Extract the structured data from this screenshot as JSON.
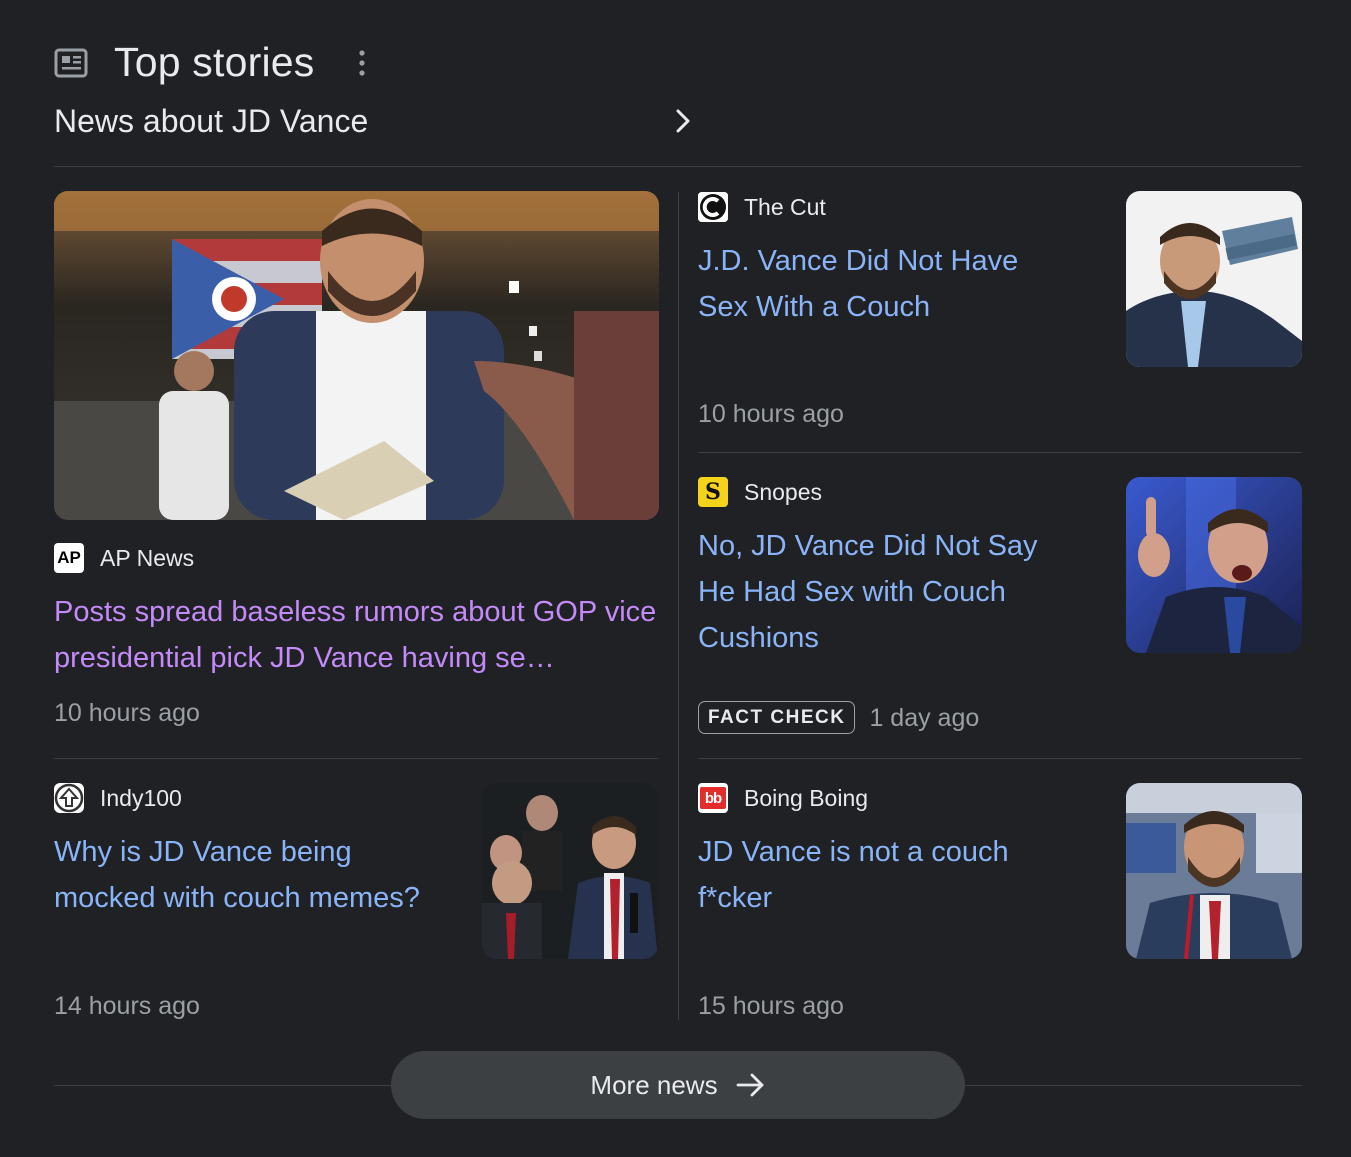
{
  "header": {
    "title": "Top stories",
    "subtitle": "News about JD Vance"
  },
  "stories": [
    {
      "source": "AP News",
      "logo_text": "AP",
      "headline": "Posts spread baseless rumors about GOP vice presidential pick JD Vance having se…",
      "time": "10 hours ago",
      "visited": true
    },
    {
      "source": "The Cut",
      "logo_text": "C",
      "headline": "J.D. Vance Did Not Have Sex With a Couch",
      "time": "10 hours ago"
    },
    {
      "source": "Snopes",
      "logo_text": "S",
      "headline": "No, JD Vance Did Not Say He Had Sex with Couch Cushions",
      "badge": "FACT CHECK",
      "time": "1 day ago"
    },
    {
      "source": "Indy100",
      "logo_text": "⇧",
      "headline": "Why is JD Vance being mocked with couch memes?",
      "time": "14 hours ago"
    },
    {
      "source": "Boing Boing",
      "logo_text": "bb",
      "headline": "JD Vance is not a couch f*cker",
      "time": "15 hours ago"
    }
  ],
  "more_news": {
    "label": "More news"
  },
  "colors": {
    "background": "#202124",
    "link": "#8ab4f8",
    "visited_link": "#c58af9",
    "secondary_text": "#9aa0a6",
    "divider": "#3c4043"
  }
}
